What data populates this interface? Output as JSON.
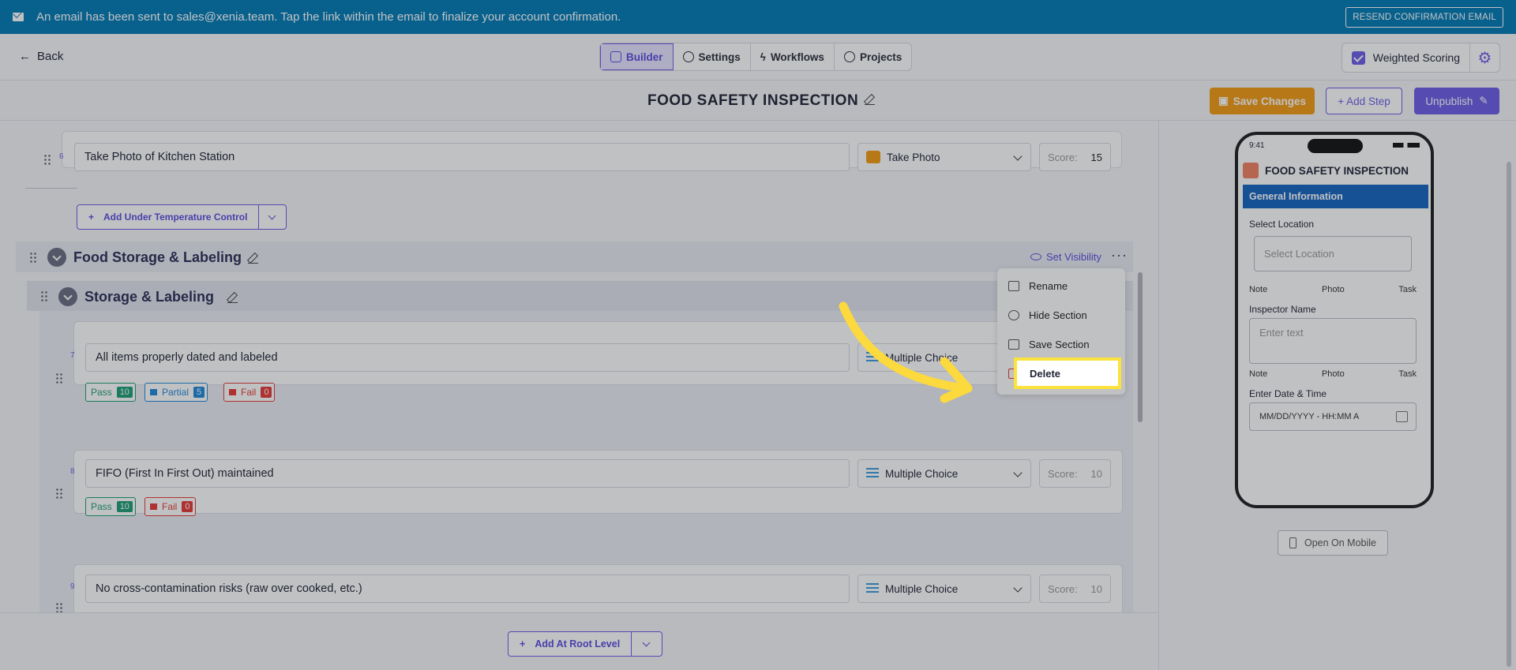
{
  "banner": {
    "message": "An email has been sent to sales@xenia.team. Tap the link within the email to finalize your account confirmation.",
    "resend_label": "RESEND CONFIRMATION EMAIL"
  },
  "nav": {
    "back_label": "Back",
    "tabs": [
      {
        "label": "Builder",
        "active": true
      },
      {
        "label": "Settings",
        "active": false
      },
      {
        "label": "Workflows",
        "active": false
      },
      {
        "label": "Projects",
        "active": false
      }
    ],
    "weighted_scoring_label": "Weighted Scoring"
  },
  "header": {
    "title": "FOOD SAFETY INSPECTION",
    "save_label": "Save Changes",
    "add_step_label": "+ Add Step",
    "unpublish_label": "Unpublish"
  },
  "builder": {
    "q6": {
      "number": "6",
      "text": "Take Photo of Kitchen Station",
      "type": "Take Photo",
      "score_label": "Score:",
      "score": "15"
    },
    "add_under_label": "Add Under Temperature Control",
    "section": {
      "title": "Food Storage & Labeling",
      "set_visibility_label": "Set Visibility"
    },
    "subsection": {
      "title": "Storage & Labeling"
    },
    "q7": {
      "number": "7",
      "text": "All items properly dated and labeled",
      "type": "Multiple Choice",
      "options": [
        {
          "label": "Pass",
          "value": "10"
        },
        {
          "label": "Partial",
          "value": "5"
        },
        {
          "label": "Fail",
          "value": "0"
        }
      ]
    },
    "q8": {
      "number": "8",
      "text": "FIFO (First In First Out) maintained",
      "type": "Multiple Choice",
      "score_label": "Score:",
      "score": "10",
      "options": [
        {
          "label": "Pass",
          "value": "10"
        },
        {
          "label": "Fail",
          "value": "0"
        }
      ]
    },
    "q9": {
      "number": "9",
      "text": "No cross-contamination risks (raw over cooked, etc.)",
      "type": "Multiple Choice",
      "score_label": "Score:",
      "score": "10"
    },
    "add_root_label": "Add At Root Level"
  },
  "menu": {
    "items": [
      "Rename",
      "Hide Section",
      "Save Section",
      "Delete"
    ]
  },
  "preview": {
    "time": "9:41",
    "title": "FOOD SAFETY INSPECTION",
    "section": "General Information",
    "select_location_label": "Select Location",
    "select_location_placeholder": "Select Location",
    "inspector_label": "Inspector Name",
    "inspector_placeholder": "Enter text",
    "date_label": "Enter Date & Time",
    "date_placeholder": "MM/DD/YYYY - HH:MM A",
    "actions": [
      "Note",
      "Photo",
      "Task"
    ],
    "open_mobile_label": "Open On Mobile"
  },
  "colors": {
    "accent": "#6c5ce7",
    "banner": "#007ab4",
    "save": "#f39a13",
    "highlight": "#fce23c"
  }
}
